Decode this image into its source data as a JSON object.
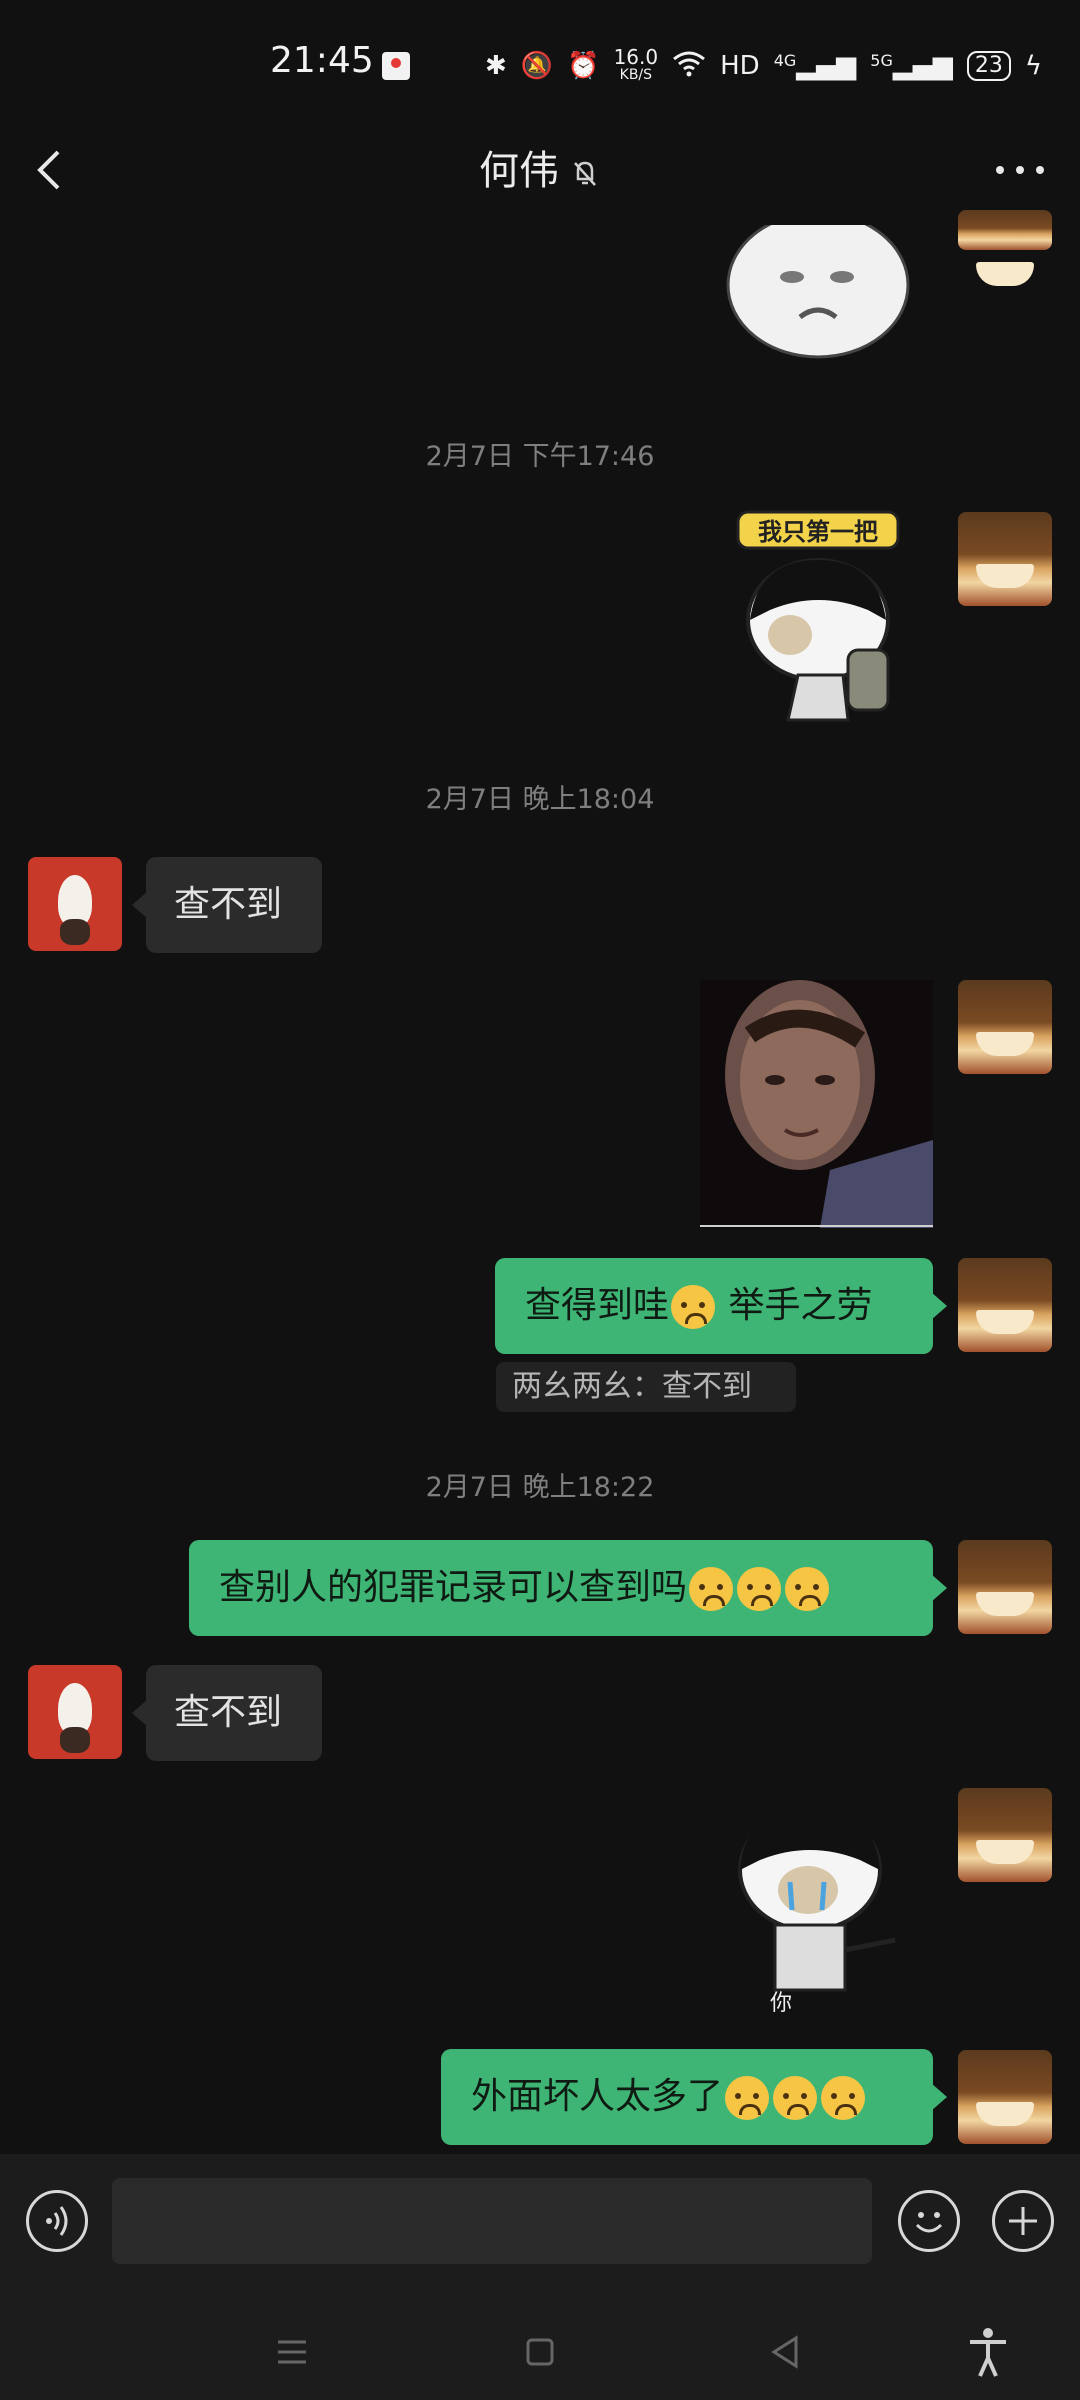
{
  "status_bar": {
    "time": "21:45",
    "speed_value": "16.0",
    "speed_unit": "KB/S",
    "hd": "HD",
    "net1": "4G",
    "net2": "5G",
    "battery": "23"
  },
  "header": {
    "title": "何伟"
  },
  "timestamps": {
    "t1": "2月7日 下午17:46",
    "t2": "2月7日 晚上18:04",
    "t3": "2月7日 晚上18:22"
  },
  "stickers": {
    "sticker2_caption": "我只第一把",
    "sticker4_caption": "你"
  },
  "messages": {
    "m1": "查不到",
    "m2_text": "查得到哇",
    "m2_text2": "举手之劳",
    "m2_quote": "两幺两幺：查不到",
    "m3": "查别人的犯罪记录可以查到吗",
    "m4": "查不到",
    "m5": "外面坏人太多了"
  },
  "input": {
    "placeholder": ""
  },
  "colors": {
    "background": "#111111",
    "bubble_self": "#3eb575",
    "bubble_other": "#2b2b2b"
  }
}
